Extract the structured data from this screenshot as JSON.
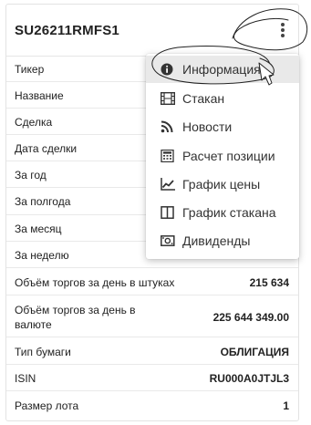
{
  "header": {
    "title": "SU26211RMFS1"
  },
  "rows": [
    {
      "label": "Тикер",
      "value": ""
    },
    {
      "label": "Название",
      "value": ""
    },
    {
      "label": "Сделка",
      "value": ""
    },
    {
      "label": "Дата сделки",
      "value": ""
    },
    {
      "label": "За год",
      "value": ""
    },
    {
      "label": "За полгода",
      "value": ""
    },
    {
      "label": "За месяц",
      "value": ""
    },
    {
      "label": "За неделю",
      "value": ""
    },
    {
      "label": "Объём торгов за день в штуках",
      "value": "215 634"
    },
    {
      "label_line1": "Объём торгов за день в",
      "label_line2": "валюте",
      "value": "225 644 349.00"
    },
    {
      "label": "Тип бумаги",
      "value": "ОБЛИГАЦИЯ"
    },
    {
      "label": "ISIN",
      "value": "RU000A0JTJL3"
    },
    {
      "label": "Размер лота",
      "value": "1"
    }
  ],
  "menu": {
    "items": [
      {
        "label": "Информация",
        "icon": "info-icon"
      },
      {
        "label": "Стакан",
        "icon": "film-icon"
      },
      {
        "label": "Новости",
        "icon": "rss-icon"
      },
      {
        "label": "Расчет позиции",
        "icon": "calculator-icon"
      },
      {
        "label": "График цены",
        "icon": "line-chart-icon"
      },
      {
        "label": "График стакана",
        "icon": "columns-icon"
      },
      {
        "label": "Дивиденды",
        "icon": "money-icon"
      }
    ]
  }
}
